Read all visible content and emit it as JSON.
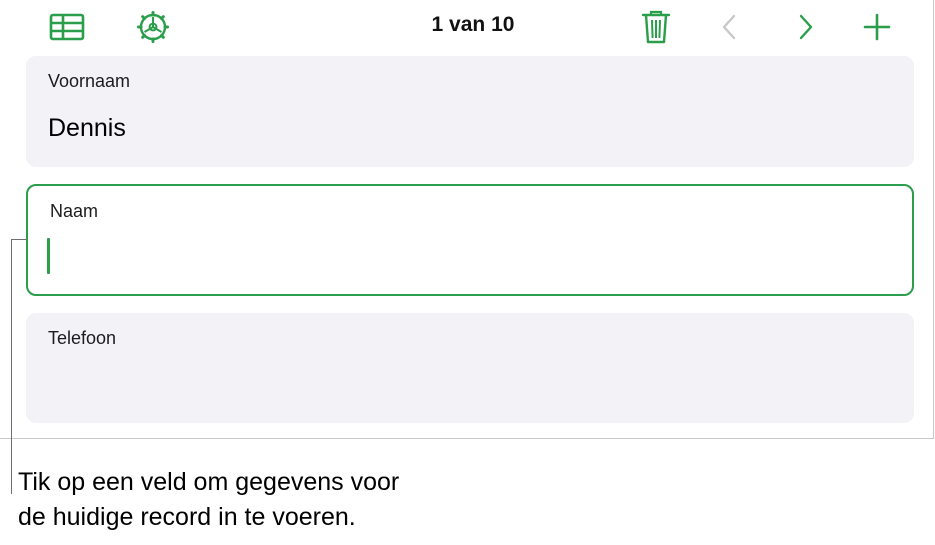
{
  "toolbar": {
    "record_counter": "1 van 10",
    "icons": {
      "view": "table-grid-icon",
      "settings": "gear-icon",
      "delete": "trash-icon",
      "previous": "chevron-left-icon",
      "next": "chevron-right-icon",
      "add": "plus-icon"
    }
  },
  "fields": [
    {
      "label": "Voornaam",
      "value": "Dennis",
      "active": false
    },
    {
      "label": "Naam",
      "value": "",
      "active": true
    },
    {
      "label": "Telefoon",
      "value": "",
      "active": false
    }
  ],
  "callout": {
    "line1": "Tik op een veld om gegevens voor",
    "line2": "de huidige record in te voeren."
  },
  "colors": {
    "accent": "#2a9e4a",
    "disabled": "#c7c7cc",
    "field_background": "#f2f2f7"
  }
}
